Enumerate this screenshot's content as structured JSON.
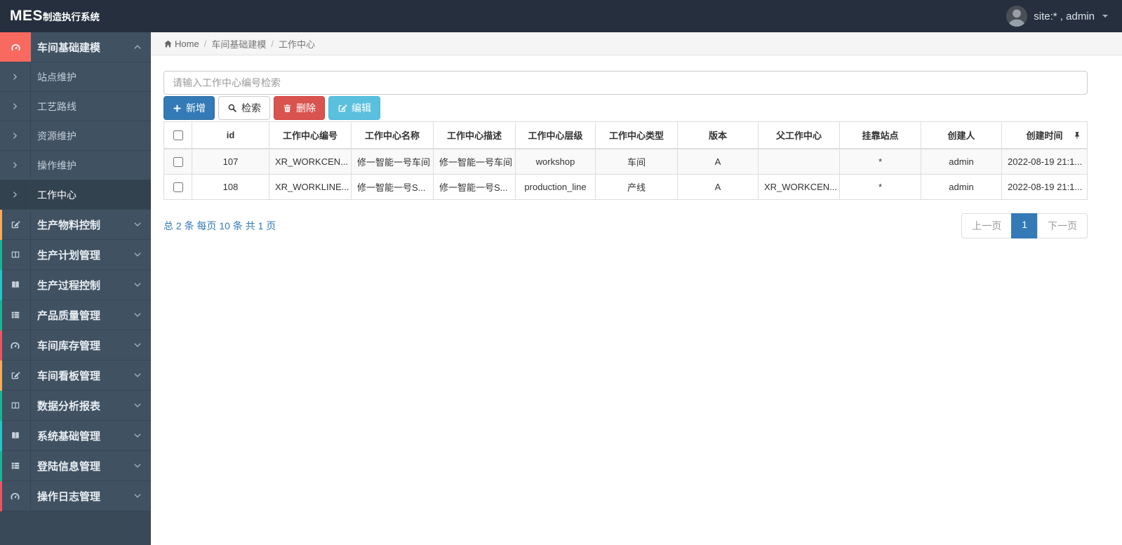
{
  "navbar": {
    "logo_primary": "MES",
    "logo_secondary": "制造执行系统",
    "user_label": "site:* , admin"
  },
  "breadcrumb": {
    "home": "Home",
    "section": "车间基础建模",
    "page": "工作中心"
  },
  "sidebar": {
    "items": [
      {
        "label": "车间基础建模",
        "icon": "dashboard-icon",
        "accent": "#f8695f",
        "expanded": true,
        "children": [
          {
            "label": "站点维护"
          },
          {
            "label": "工艺路线"
          },
          {
            "label": "资源维护"
          },
          {
            "label": "操作维护"
          },
          {
            "label": "工作中心",
            "active": true
          }
        ]
      },
      {
        "label": "生产物料控制",
        "icon": "pencil-square-icon",
        "accent": "#f8ac59"
      },
      {
        "label": "生产计划管理",
        "icon": "columns-icon",
        "accent": "#1ab394"
      },
      {
        "label": "生产过程控制",
        "icon": "book-icon",
        "accent": "#23c6c8"
      },
      {
        "label": "产品质量管理",
        "icon": "th-list-icon",
        "accent": "#1ab394"
      },
      {
        "label": "车间库存管理",
        "icon": "dashboard-icon",
        "accent": "#ed5565"
      },
      {
        "label": "车间看板管理",
        "icon": "pencil-square-icon",
        "accent": "#f8ac59"
      },
      {
        "label": "数据分析报表",
        "icon": "columns-icon",
        "accent": "#1ab394"
      },
      {
        "label": "系统基础管理",
        "icon": "book-icon",
        "accent": "#23c6c8"
      },
      {
        "label": "登陆信息管理",
        "icon": "th-list-icon",
        "accent": "#1ab394"
      },
      {
        "label": "操作日志管理",
        "icon": "dashboard-icon",
        "accent": "#ed5565"
      }
    ]
  },
  "search": {
    "placeholder": "请输入工作中心编号检索"
  },
  "toolbar": {
    "add": "新增",
    "search": "检索",
    "delete": "删除",
    "edit": "编辑"
  },
  "table": {
    "columns": [
      "id",
      "工作中心编号",
      "工作中心名称",
      "工作中心描述",
      "工作中心层级",
      "工作中心类型",
      "版本",
      "父工作中心",
      "挂靠站点",
      "创建人",
      "创建时间"
    ],
    "rows": [
      [
        "107",
        "XR_WORKCEN...",
        "修一智能一号车间",
        "修一智能一号车间",
        "workshop",
        "车间",
        "A",
        "",
        "*",
        "admin",
        "2022-08-19 21:1..."
      ],
      [
        "108",
        "XR_WORKLINE...",
        "修一智能一号S...",
        "修一智能一号S...",
        "production_line",
        "产线",
        "A",
        "XR_WORKCEN...",
        "*",
        "admin",
        "2022-08-19 21:1..."
      ]
    ]
  },
  "pagination": {
    "summary": "总 2 条 每页 10 条 共 1 页",
    "prev": "上一页",
    "current": "1",
    "next": "下一页"
  },
  "colors": {
    "navbar_bg": "#252f3e",
    "sidebar_bg": "#405262",
    "primary": "#337ab7",
    "danger": "#d9534f",
    "info": "#5bc0de",
    "active_row": "#33424f"
  }
}
